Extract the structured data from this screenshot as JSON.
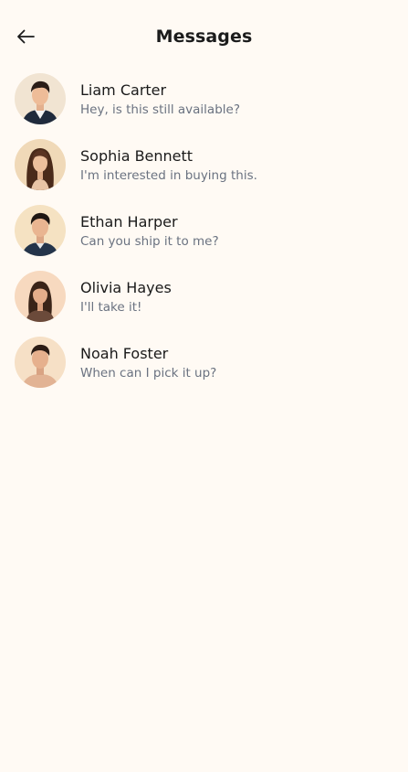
{
  "header": {
    "title": "Messages",
    "back_icon": "arrow-left-icon"
  },
  "colors": {
    "background": "#FFFAF4",
    "title": "#1b1b1b",
    "name": "#1a1a1a",
    "preview": "#6a7280"
  },
  "conversations": [
    {
      "name": "Liam Carter",
      "preview": "Hey, is this still available?",
      "avatar": "avatar-liam-carter"
    },
    {
      "name": "Sophia Bennett",
      "preview": "I'm interested in buying this.",
      "avatar": "avatar-sophia-bennett"
    },
    {
      "name": "Ethan Harper",
      "preview": "Can you ship it to me?",
      "avatar": "avatar-ethan-harper"
    },
    {
      "name": "Olivia Hayes",
      "preview": "I'll take it!",
      "avatar": "avatar-olivia-hayes"
    },
    {
      "name": "Noah Foster",
      "preview": "When can I pick it up?",
      "avatar": "avatar-noah-foster"
    }
  ]
}
